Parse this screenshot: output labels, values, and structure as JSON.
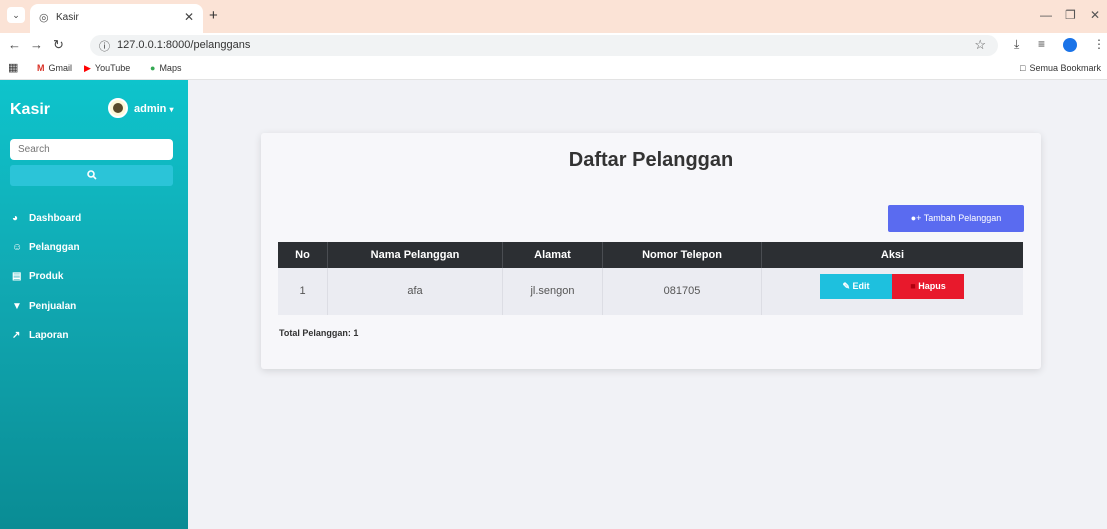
{
  "browser": {
    "tab_title": "Kasir",
    "url": "127.0.0.1:8000/pelanggans",
    "bookmarks": [
      "Gmail",
      "YouTube",
      "Maps"
    ],
    "all_bookmarks": "Semua Bookmark"
  },
  "sidebar": {
    "brand": "Kasir",
    "user": "admin",
    "search_placeholder": "Search",
    "menu": [
      {
        "label": "Dashboard",
        "icon": "dashboard-icon"
      },
      {
        "label": "Pelanggan",
        "icon": "users-icon"
      },
      {
        "label": "Produk",
        "icon": "box-icon"
      },
      {
        "label": "Penjualan",
        "icon": "cart-icon"
      },
      {
        "label": "Laporan",
        "icon": "chart-icon"
      }
    ]
  },
  "main": {
    "title": "Daftar Pelanggan",
    "add_button": "Tambah Pelanggan",
    "columns": [
      "No",
      "Nama Pelanggan",
      "Alamat",
      "Nomor Telepon",
      "Aksi"
    ],
    "rows": [
      {
        "no": "1",
        "nama": "afa",
        "alamat": "jl.sengon",
        "telepon": "081705"
      }
    ],
    "edit_label": "Edit",
    "delete_label": "Hapus",
    "total": "Total Pelanggan: 1"
  },
  "colors": {
    "sidebar": "#11a9b3",
    "primary": "#5a6bf0",
    "info": "#1ec0de",
    "danger": "#e8192c",
    "table_head": "#2c2f33"
  }
}
